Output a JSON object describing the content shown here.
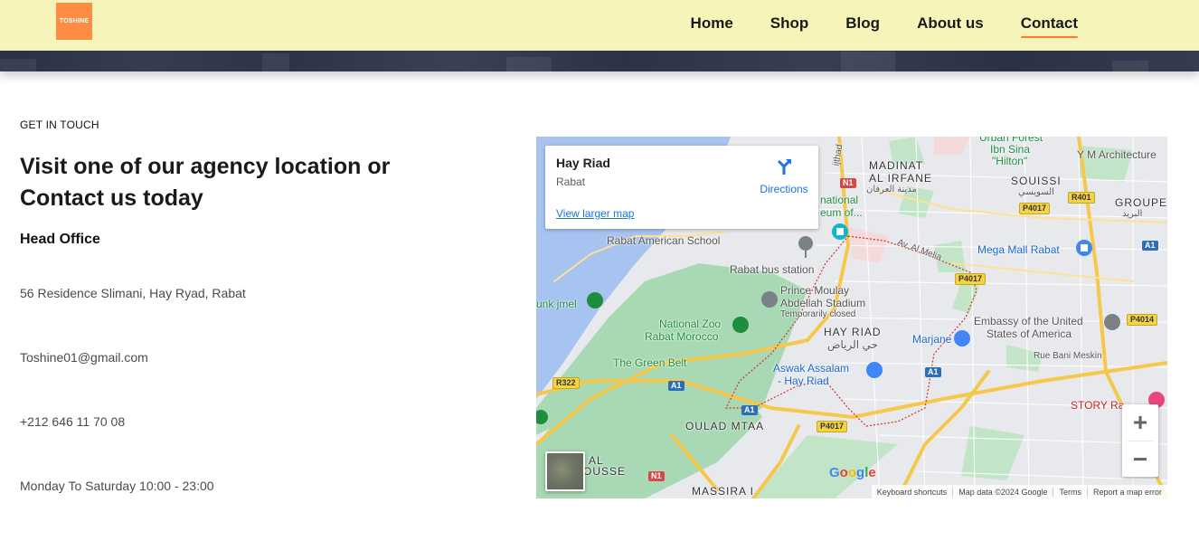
{
  "header": {
    "logo_text": "TOSHINE",
    "nav": [
      {
        "label": "Home",
        "active": false
      },
      {
        "label": "Shop",
        "active": false
      },
      {
        "label": "Blog",
        "active": false
      },
      {
        "label": "About us",
        "active": false
      },
      {
        "label": "Contact",
        "active": true
      }
    ],
    "accent_color": "#ff7a2c",
    "background_color": "#f6f4b9"
  },
  "contact": {
    "eyebrow": "GET IN TOUCH",
    "headline": "Visit one of our agency location or Contact us today",
    "office_title": "Head Office",
    "address": "56 Residence Slimani, Hay Ryad, Rabat",
    "email": "Toshine01@gmail.com",
    "phone": "+212 646 11 70 08",
    "hours": "Monday To Saturday 10:00 - 23:00"
  },
  "map": {
    "place_card": {
      "title": "Hay Riad",
      "subtitle": "Rabat",
      "directions_label": "Directions",
      "larger_map_label": "View larger map"
    },
    "labels": {
      "madinat": "MADINAT",
      "al_irfane": "AL IRFANE",
      "irfane_ar": "مدينة العرفان",
      "urban_forest": "Urban Forest",
      "ibn_sina": "Ibn Sina",
      "hilton": "\"Hilton\"",
      "ym_arch": "Y M Architecture",
      "souissi": "SOUISSI",
      "souissi_ar": "السويسي",
      "groupe": "GROUPE",
      "groupe_ar": "البريد",
      "national_museum_1": "national",
      "national_museum_2": "eum of...",
      "american_school": "Rabat American School",
      "bus_station": "Rabat bus station",
      "mega_mall": "Mega Mall Rabat",
      "stadium_1": "Prince Moulay",
      "stadium_2": "Abdellah Stadium",
      "stadium_note": "Temporarily closed",
      "funk": "unk jmel",
      "zoo_1": "National Zoo",
      "zoo_2": "Rabat Morocco",
      "hay_riad": "HAY RIAD",
      "hay_riad_ar": "حي الرياض",
      "marjane": "Marjane",
      "embassy_1": "Embassy of the United",
      "embassy_2": "States of America",
      "green_belt": "The Green Belt",
      "aswak_1": "Aswak Assalam",
      "aswak_2": "- Hay Riad",
      "bani_meskin": "Rue Bani Meskin",
      "story": "STORY Ra",
      "oulad_mtaa": "OULAD MTAA",
      "al_1": "AL",
      "al_2": "OUSSE",
      "massira": "MASSIRA I",
      "al_melia": "Av. Al Melia",
      "ijthad": "ijthad"
    },
    "shields": {
      "n1_top": "N1",
      "r401": "R401",
      "p4017_a": "P4017",
      "a1_right": "A1",
      "p4017_b": "P4017",
      "p4014": "P4014",
      "a1_mid": "A1",
      "r322": "R322",
      "a1_left": "A1",
      "a1_center": "A1",
      "p4017_c": "P4017",
      "n1_bottom": "N1"
    },
    "zoom_in": "+",
    "zoom_out": "−",
    "google": "Google",
    "attribution": [
      "Keyboard shortcuts",
      "Map data ©2024 Google",
      "Terms",
      "Report a map error"
    ]
  }
}
